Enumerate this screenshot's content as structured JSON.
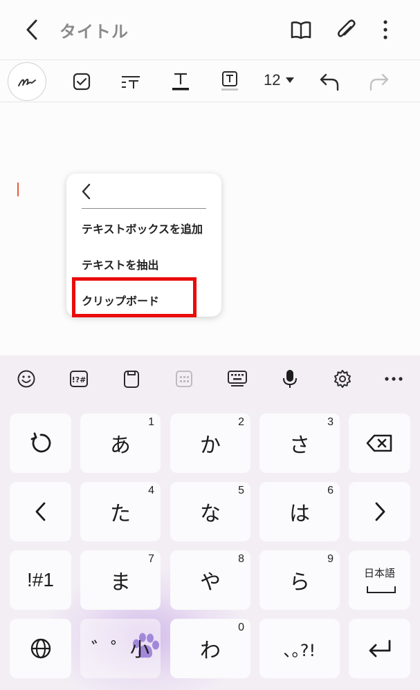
{
  "header": {
    "title": "タイトル",
    "icons": [
      "back-arrow-icon",
      "book-icon",
      "paperclip-icon",
      "more-vertical-icon"
    ]
  },
  "toolbar": {
    "tools": [
      "pen-icon",
      "checkbox-icon",
      "text-style-icon",
      "text-underline-icon",
      "text-highlight-icon"
    ],
    "font_size": "12",
    "actions": [
      "undo-icon",
      "redo-icon"
    ]
  },
  "popup": {
    "items": [
      {
        "label": "テキストボックスを追加"
      },
      {
        "label": "テキストを抽出"
      },
      {
        "label": "クリップボード"
      }
    ]
  },
  "keyboard": {
    "toolbar": [
      "emoji-icon",
      "symbols-icon",
      "clipboard-icon",
      "numpad-icon",
      "keyboard-icon",
      "mic-icon",
      "settings-icon",
      "more-horizontal-icon"
    ],
    "rows": [
      [
        {
          "label": "",
          "icon": "undo-circle-icon"
        },
        {
          "label": "あ",
          "num": "1"
        },
        {
          "label": "か",
          "num": "2"
        },
        {
          "label": "さ",
          "num": "3"
        },
        {
          "label": "",
          "icon": "backspace-icon"
        }
      ],
      [
        {
          "label": "",
          "icon": "arrow-left-icon"
        },
        {
          "label": "た",
          "num": "4"
        },
        {
          "label": "な",
          "num": "5"
        },
        {
          "label": "は",
          "num": "6"
        },
        {
          "label": "",
          "icon": "arrow-right-icon"
        }
      ],
      [
        {
          "label": "!#1"
        },
        {
          "label": "ま",
          "num": "7"
        },
        {
          "label": "や",
          "num": "8"
        },
        {
          "label": "ら",
          "num": "9"
        },
        {
          "label": "日本語",
          "icon": "space-icon"
        }
      ],
      [
        {
          "label": "",
          "icon": "globe-icon"
        },
        {
          "label": "゛゜小"
        },
        {
          "label": "わ",
          "num": "0"
        },
        {
          "label": "､｡?!"
        },
        {
          "label": "",
          "icon": "enter-icon"
        }
      ]
    ]
  }
}
